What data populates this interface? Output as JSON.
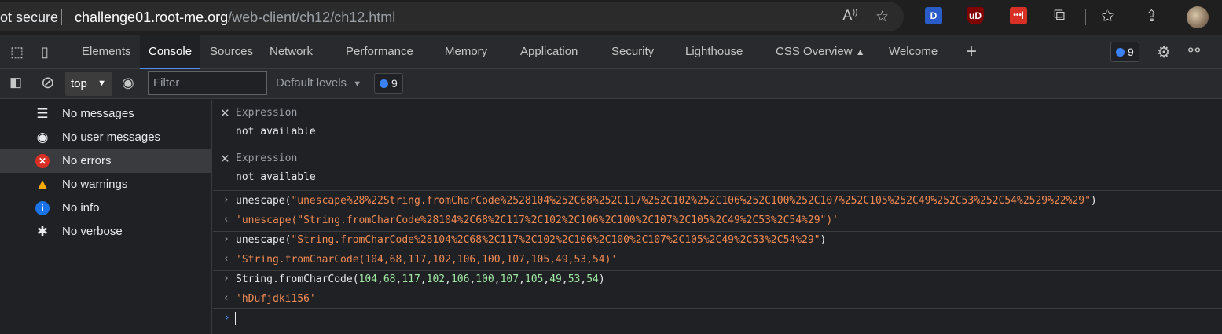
{
  "address_bar": {
    "security_label": "ot secure",
    "url_host": "challenge01.root-me.org",
    "url_path": "/web-client/ch12/ch12.html"
  },
  "toolbar": {
    "extensions": [
      {
        "name": "D",
        "color": "#2a5cc9"
      },
      {
        "name": "uD",
        "color": "#800000"
      },
      {
        "name": "•••|",
        "color": "#d93025"
      }
    ]
  },
  "devtools": {
    "tabs": [
      {
        "label": "Elements"
      },
      {
        "label": "Console"
      },
      {
        "label": "Sources"
      },
      {
        "label": "Network"
      },
      {
        "label": "Performance"
      },
      {
        "label": "Memory"
      },
      {
        "label": "Application"
      },
      {
        "label": "Security"
      },
      {
        "label": "Lighthouse"
      },
      {
        "label": "CSS Overview"
      },
      {
        "label": "Welcome"
      }
    ],
    "active_tab": "Console",
    "issues_count": "9"
  },
  "console_toolbar": {
    "context": "top",
    "filter_placeholder": "Filter",
    "levels": "Default levels",
    "issues_count": "9"
  },
  "sidebar": {
    "items": [
      {
        "label": "No messages"
      },
      {
        "label": "No user messages"
      },
      {
        "label": "No errors"
      },
      {
        "label": "No warnings"
      },
      {
        "label": "No info"
      },
      {
        "label": "No verbose"
      }
    ],
    "selected": "No errors"
  },
  "console": {
    "expressions": [
      {
        "label": "Expression",
        "value": "not available"
      },
      {
        "label": "Expression",
        "value": "not available"
      }
    ],
    "entries": [
      {
        "input_fn": "unescape(",
        "input_arg": "\"unescape%28%22String.fromCharCode%2528104%252C68%252C117%252C102%252C106%252C100%252C107%252C105%252C49%252C53%252C54%2529%22%29\"",
        "input_close": ")",
        "output": "'unescape(\"String.fromCharCode%28104%2C68%2C117%2C102%2C106%2C100%2C107%2C105%2C49%2C53%2C54%29\")'"
      },
      {
        "input_fn": "unescape(",
        "input_arg": "\"String.fromCharCode%28104%2C68%2C117%2C102%2C106%2C100%2C107%2C105%2C49%2C53%2C54%29\"",
        "input_close": ")",
        "output": "'String.fromCharCode(104,68,117,102,106,100,107,105,49,53,54)'"
      },
      {
        "input_fn": "String.fromCharCode(",
        "input_numbers": [
          "104",
          "68",
          "117",
          "102",
          "106",
          "100",
          "107",
          "105",
          "49",
          "53",
          "54"
        ],
        "input_close": ")",
        "output": "'hDufjdki156'"
      }
    ]
  }
}
